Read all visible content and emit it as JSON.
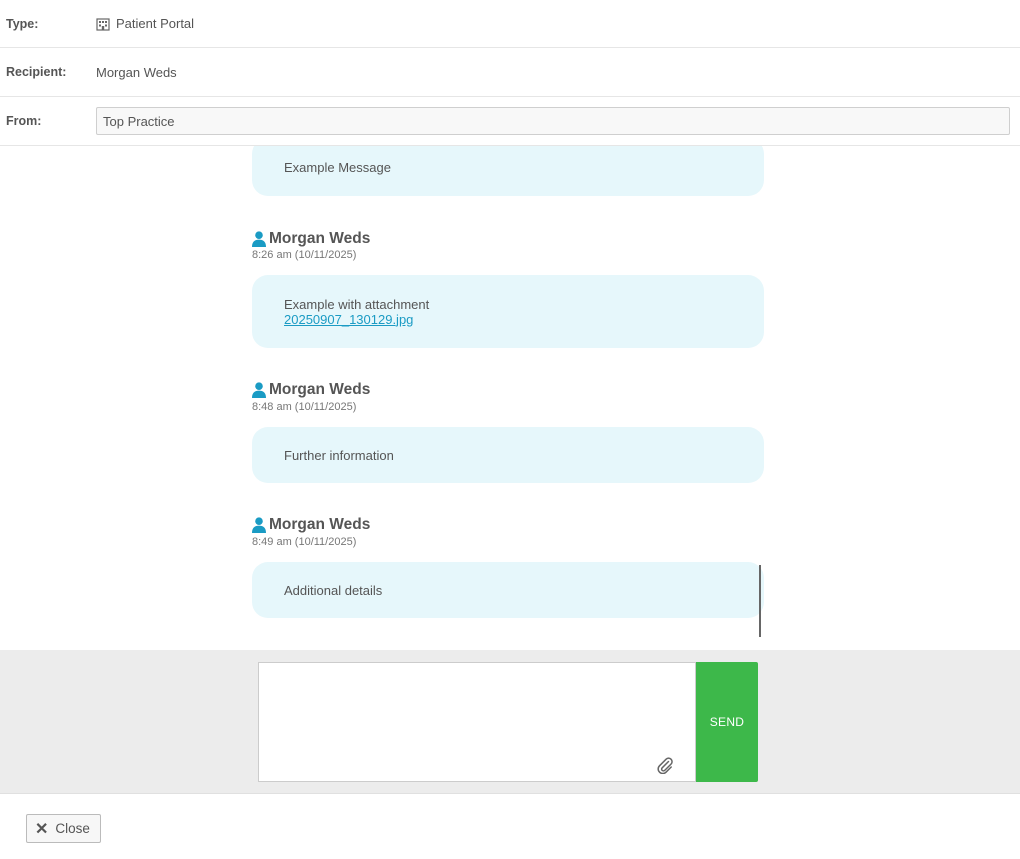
{
  "header": {
    "type_label": "Type:",
    "type_value": "Patient Portal",
    "type_icon": "building-icon",
    "recipient_label": "Recipient:",
    "recipient_value": "Morgan Weds",
    "from_label": "From:",
    "from_value": "Top Practice"
  },
  "messages": [
    {
      "text": "Example Message"
    },
    {
      "sender": "Morgan Weds",
      "time": "8:26 am (10/11/2025)",
      "text": "Example with attachment",
      "attachment": "20250907_130129.jpg"
    },
    {
      "sender": "Morgan Weds",
      "time": "8:48 am (10/11/2025)",
      "text": "Further information"
    },
    {
      "sender": "Morgan Weds",
      "time": "8:49 am (10/11/2025)",
      "text": "Additional details"
    }
  ],
  "compose": {
    "placeholder": "",
    "send_label": "SEND",
    "attach_icon": "paperclip-icon"
  },
  "footer": {
    "close_label": "Close"
  },
  "colors": {
    "accent": "#1a9bc4",
    "bubble": "#e6f7fb",
    "send": "#3db84a"
  }
}
